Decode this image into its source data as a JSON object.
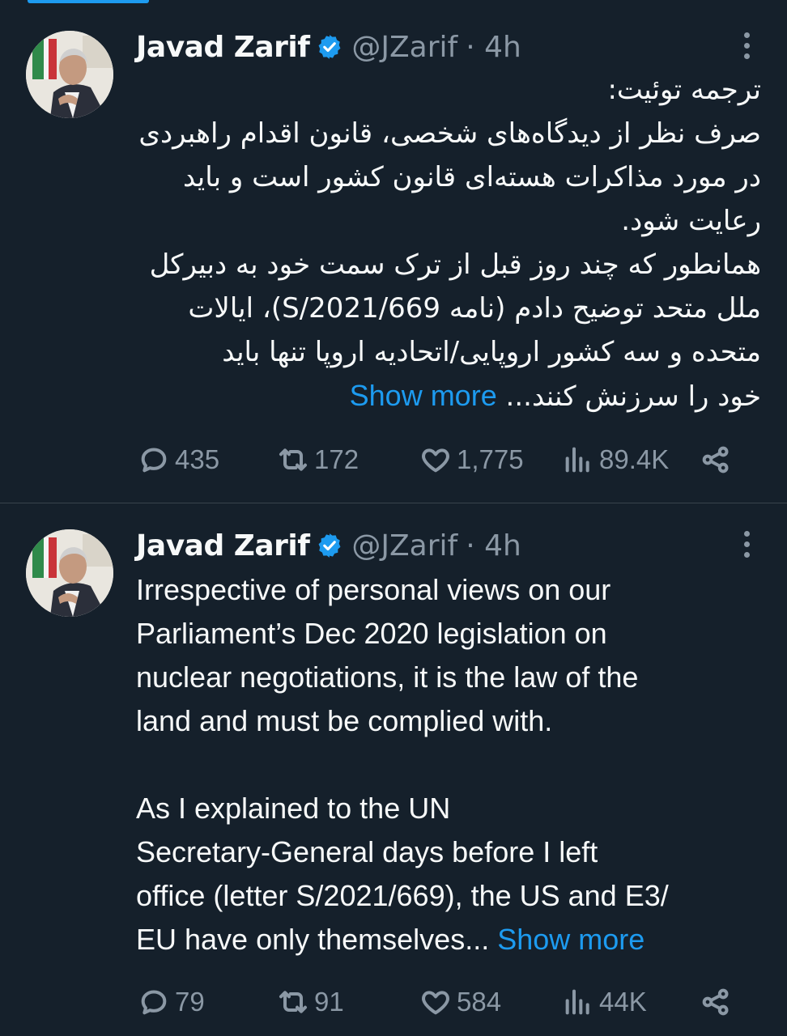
{
  "tweets": [
    {
      "name": "Javad Zarif",
      "handle": "@JZarif",
      "time": "· 4h",
      "lines": [
        "ترجمه توئیت:",
        "صرف نظر از دیدگاه‌های شخصی، قانون اقدام راهبردی",
        "در مورد مذاکرات هسته‌ای قانون کشور است و باید",
        "رعایت شود.",
        "همانطور که  چند روز قبل از ترک سمت خود به دبیرکل",
        "ملل متحد توضیح دادم (نامه S/2021/669)، ایالات",
        "متحده و سه کشور اروپایی/اتحادیه اروپا تنها باید",
        "خود را سرزنش کنند..."
      ],
      "show_more": "Show more",
      "replies": "435",
      "retweets": "172",
      "likes": "1,775",
      "views": "89.4K"
    },
    {
      "name": "Javad Zarif",
      "handle": "@JZarif",
      "time": "· 4h",
      "paragraph1": [
        "Irrespective of personal views on our",
        "Parliament’s Dec 2020 legislation on",
        "nuclear negotiations, it is the law of the",
        "land and must be complied with."
      ],
      "paragraph2": [
        "As I explained to the UN",
        "Secretary-General days before I left",
        "office (letter S/2021/669), the US and E3/",
        "EU have only themselves..."
      ],
      "show_more": "Show more",
      "replies": "79",
      "retweets": "91",
      "likes": "584",
      "views": "44K"
    }
  ],
  "colors": {
    "background": "#15202b",
    "accent": "#1d9bf0",
    "secondary_text": "#8b98a5",
    "divider": "#38444d"
  },
  "icons": [
    "verified-badge-icon",
    "more-options-icon",
    "reply-icon",
    "retweet-icon",
    "like-icon",
    "views-icon",
    "share-icon"
  ]
}
